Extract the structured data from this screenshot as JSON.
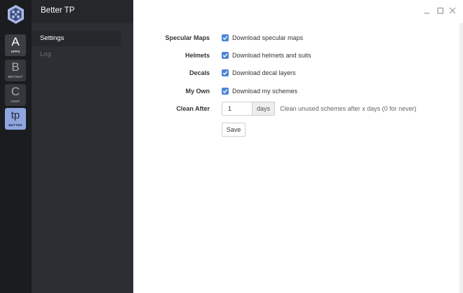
{
  "rail": {
    "items": [
      {
        "glyph": "A",
        "caption": "APPS"
      },
      {
        "glyph": "B",
        "caption": "BETSKIT"
      },
      {
        "glyph": "C",
        "caption": "CHAT"
      },
      {
        "glyph": "tp",
        "caption": "BETTER"
      }
    ],
    "active_color": "#8fa5e0"
  },
  "nav": {
    "title": "Better TP",
    "items": [
      {
        "label": "Settings",
        "active": true
      },
      {
        "label": "Log",
        "active": false
      }
    ]
  },
  "window_controls": [
    "minimize-icon",
    "maximize-icon",
    "close-icon"
  ],
  "form": {
    "specular": {
      "label": "Specular Maps",
      "option": "Download specular maps",
      "checked": true
    },
    "helmets": {
      "label": "Helmets",
      "option": "Download helmets and suits",
      "checked": true
    },
    "decals": {
      "label": "Decals",
      "option": "Download decal layers",
      "checked": true
    },
    "myown": {
      "label": "My Own",
      "option": "Download my schemes",
      "checked": true
    },
    "clean_after": {
      "label": "Clean After",
      "value": "1",
      "unit": "days",
      "help": "Clean unused schemes after x days (0 for never)"
    },
    "save_label": "Save"
  },
  "colors": {
    "checkbox": "#4a86d8",
    "rail_bg": "#1b1c1f",
    "nav_bg": "#2c2e33"
  }
}
